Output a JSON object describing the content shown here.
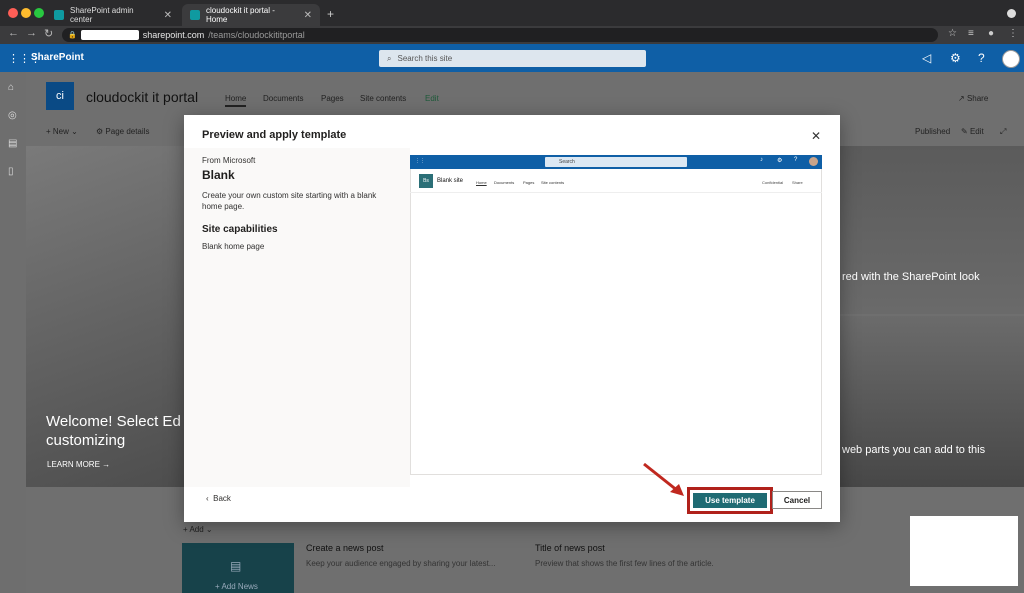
{
  "browser": {
    "tabs": [
      {
        "label": "SharePoint admin center"
      },
      {
        "label": "cloudockit it portal - Home"
      }
    ],
    "new_tab": "+",
    "url_host": "sharepoint.com",
    "url_path": "/teams/cloudockititportal"
  },
  "suite": {
    "brand": "SharePoint",
    "search_placeholder": "Search this site"
  },
  "site": {
    "logo_text": "ci",
    "title": "cloudockit it portal",
    "nav": [
      "Home",
      "Documents",
      "Pages",
      "Site contents",
      "Edit"
    ],
    "share": "Share",
    "cmd_new": "New",
    "cmd_page_details": "Page details",
    "cmd_published": "Published",
    "cmd_edit": "Edit"
  },
  "hero": {
    "welcome": "Welcome! Select Ed customizing",
    "learn_more": "LEARN MORE",
    "right_top": "red with the SharePoint look",
    "right_bottom": "web parts you can add to this"
  },
  "news": {
    "add": "Add",
    "add_news": "+ Add News",
    "post1_title": "Create a news post",
    "post1_desc": "Keep your audience engaged by sharing your latest...",
    "post2_title": "Title of news post",
    "post2_desc": "Preview that shows the first few lines of the article."
  },
  "modal": {
    "title": "Preview and apply template",
    "from": "From Microsoft",
    "template_name": "Blank",
    "description": "Create your own custom site starting with a blank home page.",
    "capabilities_heading": "Site capabilities",
    "capabilities": [
      "Blank home page"
    ],
    "back": "Back",
    "use_template": "Use template",
    "cancel": "Cancel",
    "preview": {
      "search": "Search",
      "logo_text": "Bs",
      "site_title": "Blank site",
      "nav": [
        "Home",
        "Documents",
        "Pages",
        "Site contents"
      ],
      "confidential": "Confidential",
      "share": "Share"
    }
  },
  "colors": {
    "suite_bar": "#0f5fa6",
    "use_template_button": "#1f6b73",
    "highlight_border": "#b0211b"
  }
}
